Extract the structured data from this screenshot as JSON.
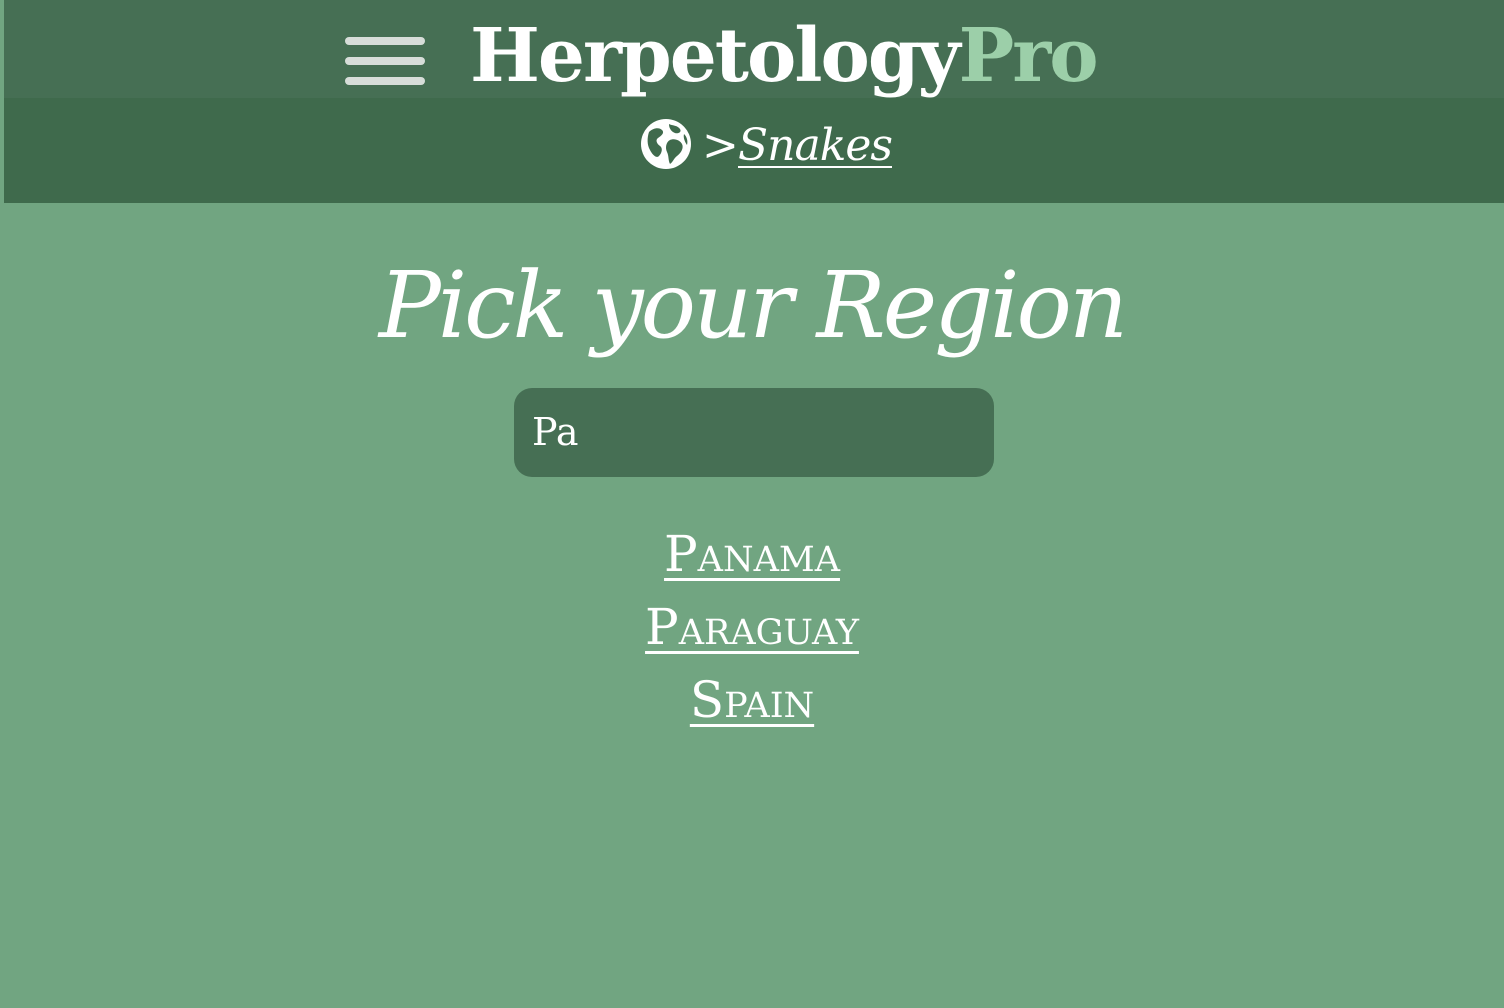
{
  "colors": {
    "background": "#71a581",
    "header_bottom": "#3f6a4c",
    "header_top": "#466f54",
    "search_bg": "#466f54",
    "brand_accent": "#9ccfa9",
    "text": "#ffffff"
  },
  "header": {
    "menu_icon": "hamburger-icon",
    "brand": {
      "main": "Herpetology",
      "accent": "Pro"
    },
    "breadcrumb": {
      "home_icon": "globe-icon",
      "separator": ">",
      "current": "Snakes"
    }
  },
  "main": {
    "title": "Pick your Region",
    "search": {
      "value": "Pa",
      "placeholder": ""
    },
    "results": [
      {
        "label": "Panama"
      },
      {
        "label": "Paraguay"
      },
      {
        "label": "Spain"
      }
    ]
  }
}
